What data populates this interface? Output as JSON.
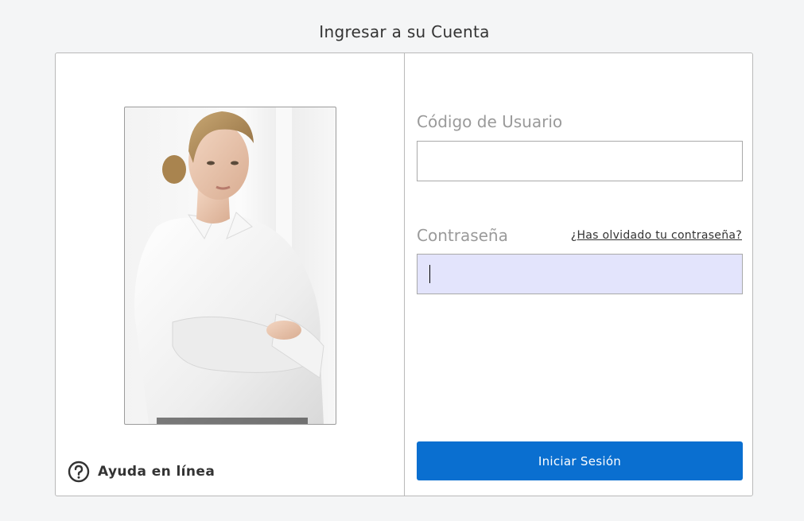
{
  "page": {
    "title": "Ingresar a su Cuenta"
  },
  "left": {
    "portrait_icon": "businesswoman-photo",
    "help": {
      "icon": "question-circle-icon",
      "label": "Ayuda en línea"
    }
  },
  "form": {
    "username": {
      "label": "Código de Usuario",
      "value": ""
    },
    "password": {
      "label": "Contraseña",
      "value": "",
      "forgot_link": "¿Has olvidado tu contraseña?"
    },
    "submit_label": "Iniciar Sesión"
  },
  "colors": {
    "primary_button": "#0a6fd0",
    "focused_input": "#e3e4fc",
    "page_background": "#f4f5f6"
  }
}
